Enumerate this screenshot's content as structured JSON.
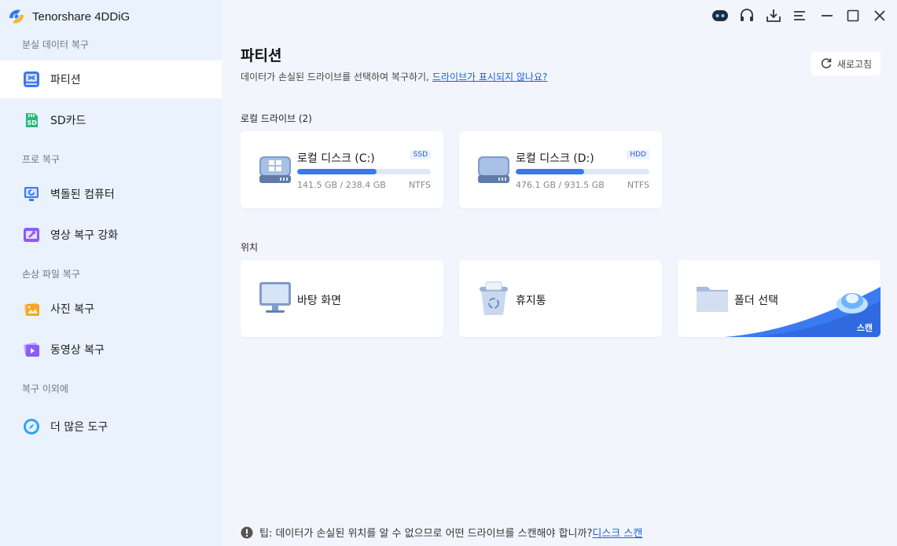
{
  "app": {
    "title": "Tenorshare 4DDiG"
  },
  "sidebar": {
    "sections": [
      {
        "label": "분실 데이터 복구"
      },
      {
        "label": "프로 복구"
      },
      {
        "label": "손상 파일 복구"
      },
      {
        "label": "복구 이외에"
      }
    ],
    "items": [
      {
        "label": "파티션",
        "icon": "partition-icon"
      },
      {
        "label": "SD카드",
        "icon": "sd-card-icon"
      },
      {
        "label": "벽돌된 컴퓨터",
        "icon": "crashed-computer-icon"
      },
      {
        "label": "영상 복구 강화",
        "icon": "video-repair-icon"
      },
      {
        "label": "사진 복구",
        "icon": "photo-icon"
      },
      {
        "label": "동영상 복구",
        "icon": "video-icon"
      },
      {
        "label": "더 많은 도구",
        "icon": "compass-icon"
      }
    ]
  },
  "main": {
    "title": "파티션",
    "subtitle": "데이터가 손실된 드라이브를 선택하여 복구하기,",
    "subtitle_link": "드라이브가 표시되지 않나요?",
    "refresh_label": "새로고침",
    "local_drives_header": "로컬 드라이브 (2)",
    "drives": [
      {
        "name": "로컬 디스크 (C:)",
        "type": "SSD",
        "size": "141.5 GB / 238.4 GB",
        "fs": "NTFS",
        "used_fraction": 0.594
      },
      {
        "name": "로컬 디스크 (D:)",
        "type": "HDD",
        "size": "476.1 GB / 931.5 GB",
        "fs": "NTFS",
        "used_fraction": 0.511
      }
    ],
    "locations_header": "위치",
    "locations": [
      {
        "label": "바탕 화면",
        "icon": "desktop-icon"
      },
      {
        "label": "휴지통",
        "icon": "recycle-bin-icon"
      },
      {
        "label": "폴더 선택",
        "icon": "folder-icon",
        "badge": "스캔"
      }
    ],
    "tip_text": "팁: 데이터가 손실된 위치를 알 수 없으므로 어떤 드라이브를 스캔해야 합니까?",
    "tip_link": "디스크 스캔"
  },
  "colors": {
    "accent": "#3a79ea",
    "link": "#1f5fd6",
    "sidebar_bg": "#e9f2fd",
    "main_bg": "#f2f6fc"
  }
}
